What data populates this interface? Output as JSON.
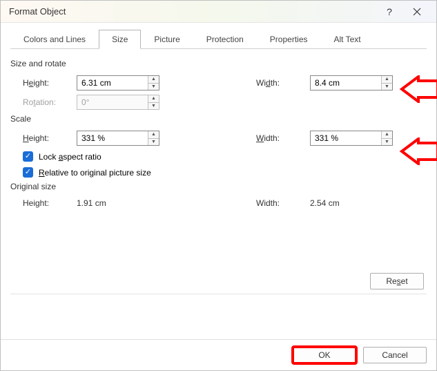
{
  "dialog": {
    "title": "Format Object",
    "help": "?",
    "close": "✕"
  },
  "tabs": {
    "colors_lines": "Colors and Lines",
    "size": "Size",
    "picture": "Picture",
    "protection": "Protection",
    "properties": "Properties",
    "alt_text": "Alt Text"
  },
  "size_rotate": {
    "label": "Size and rotate",
    "height_label": "Height:",
    "height_value": "6.31 cm",
    "width_label": "Width:",
    "width_value": "8.4 cm",
    "rotation_label": "Rotation:",
    "rotation_value": "0°"
  },
  "scale": {
    "label": "Scale",
    "height_label": "Height:",
    "height_value": "331 %",
    "width_label": "Width:",
    "width_value": "331 %",
    "lock_text": "Lock aspect ratio",
    "lock_prefix": "Lock ",
    "lock_letter": "a",
    "lock_suffix": "spect ratio",
    "relative_prefix": "R",
    "relative_suffix": "elative to original picture size"
  },
  "original": {
    "label": "Original size",
    "height_label": "Height:",
    "height_value": "1.91 cm",
    "width_label": "Width:",
    "width_value": "2.54 cm"
  },
  "buttons": {
    "reset": "Reset",
    "reset_prefix": "Re",
    "reset_letter": "s",
    "reset_suffix": "et",
    "ok": "OK",
    "cancel": "Cancel"
  }
}
